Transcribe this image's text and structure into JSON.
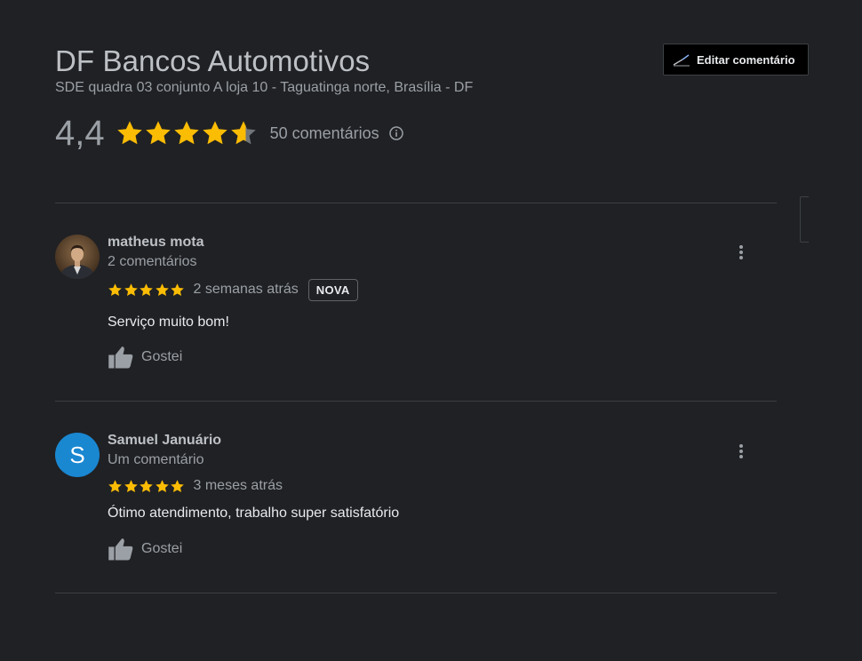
{
  "business": {
    "name": "DF Bancos Automotivos",
    "address": "SDE quadra 03 conjunto A loja 10 - Taguatinga norte, Brasília - DF"
  },
  "edit_button": {
    "label": "Editar comentário",
    "icon": "edit-pen-icon"
  },
  "rating": {
    "value_text": "4,4",
    "value": 4.4,
    "max": 5,
    "count_text": "50 comentários",
    "info_icon": "info-icon"
  },
  "colors": {
    "background": "#202124",
    "star": "#fbbc04",
    "star_empty": "#70757a",
    "avatar_blue": "#1a87d1"
  },
  "reviews": [
    {
      "author": "matheus mota",
      "author_reviews": "2 comentários",
      "avatar": "profile-photo",
      "stars": 5,
      "date": "2 semanas atrás",
      "badge": "NOVA",
      "text": "Serviço muito bom!",
      "like_label": "Gostei"
    },
    {
      "author": "Samuel Januário",
      "author_reviews": "Um comentário",
      "avatar_letter": "S",
      "stars": 5,
      "date": "3 meses atrás",
      "text": "Ótimo atendimento, trabalho super satisfatório",
      "like_label": "Gostei"
    }
  ]
}
